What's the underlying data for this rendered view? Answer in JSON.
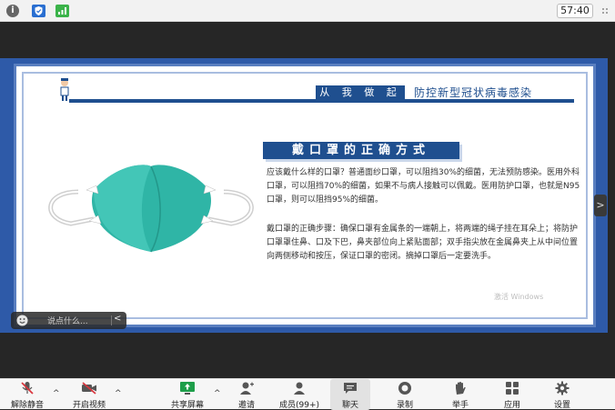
{
  "system_bar": {
    "info_icon": "info-icon",
    "shield_icon": "shield-icon",
    "signal_icon": "signal-icon",
    "time": "57:40",
    "info_glyph": "i"
  },
  "slide": {
    "slogan_highlight": "从 我 做 起",
    "slogan_tail": "防控新型冠状病毒感染",
    "title": "戴口罩的正确方式",
    "paragraph1": "应该戴什么样的口罩？普通面纱口罩，可以阻挡30%的细菌，无法预防感染。医用外科口罩，可以阻挡70%的细菌，如果不与病人接触可以佩戴。医用防护口罩，也就是N95口罩，则可以阻挡95%的细菌。",
    "paragraph2": "戴口罩的正确步骤：确保口罩有金属条的一端朝上，将两端的绳子挂在耳朵上；将防护口罩罩住鼻、口及下巴，鼻夹部位向上紧贴面部；双手指尖放在金属鼻夹上从中间位置向两侧移动和按压，保证口罩的密闭。摘掉口罩后一定要洗手。",
    "watermark": "激活 Windows"
  },
  "chat": {
    "placeholder": "说点什么...",
    "collapse": "<"
  },
  "side_handle": ">",
  "toolbar": {
    "items": [
      {
        "label": "解除静音",
        "icon": "microphone-muted-icon"
      },
      {
        "label": "开启视频",
        "icon": "video-off-icon"
      },
      {
        "label": "共享屏幕",
        "icon": "share-screen-icon"
      },
      {
        "label": "邀请",
        "icon": "invite-icon"
      },
      {
        "label": "成员(99+)",
        "icon": "members-icon"
      },
      {
        "label": "聊天",
        "icon": "chat-icon"
      },
      {
        "label": "录制",
        "icon": "record-icon"
      },
      {
        "label": "举手",
        "icon": "raise-hand-icon"
      },
      {
        "label": "应用",
        "icon": "apps-icon"
      },
      {
        "label": "设置",
        "icon": "gear-icon"
      }
    ],
    "caret": "^"
  },
  "colors": {
    "slide_blue": "#1f4f8f",
    "share_frame": "#2e5aa8",
    "mask_teal": "#2fb5a6",
    "muted_red": "#d9363e"
  }
}
